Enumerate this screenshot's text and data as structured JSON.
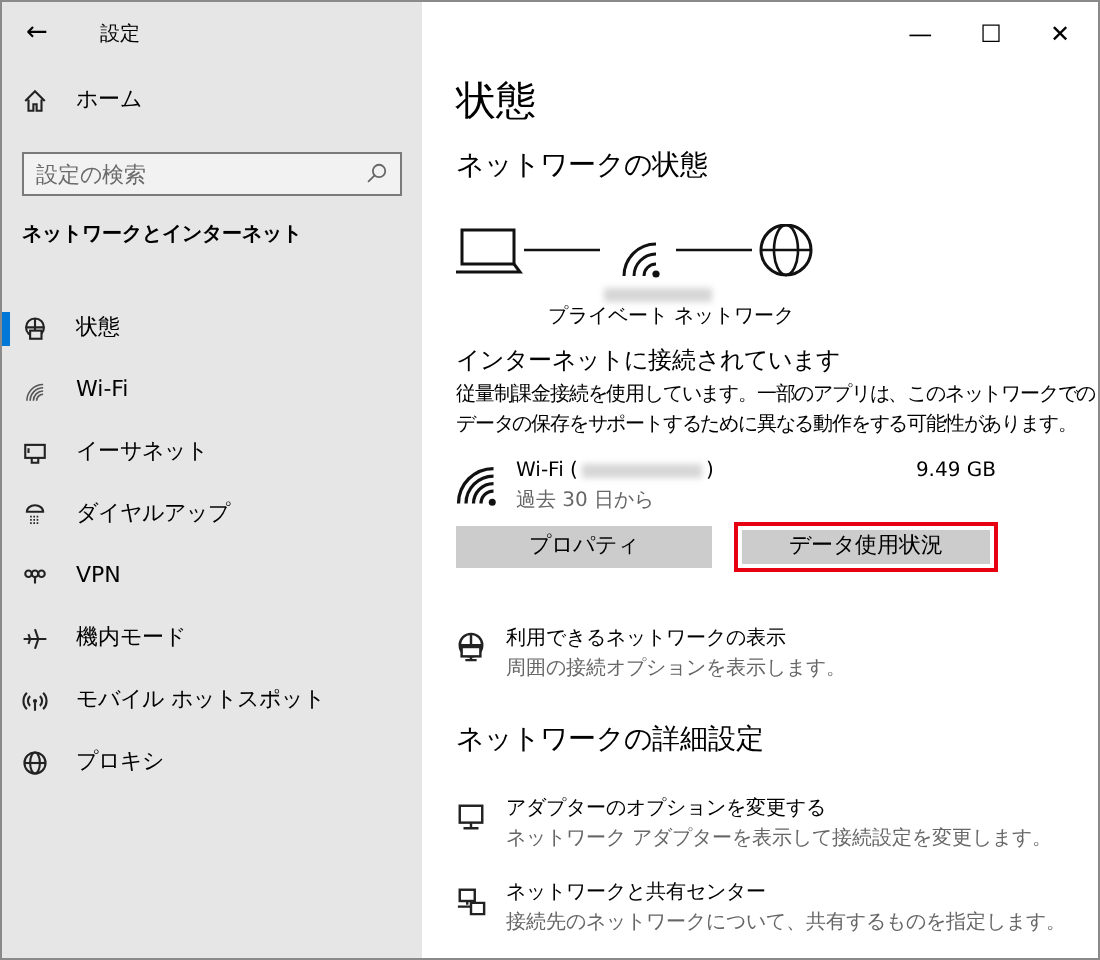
{
  "window": {
    "title": "設定",
    "back": "←",
    "controls": [
      "—",
      "☐",
      "✕"
    ]
  },
  "sidebar": {
    "home": "ホーム",
    "search": {
      "placeholder": "設定の検索"
    },
    "section": "ネットワークとインターネット",
    "items": [
      {
        "label": "状態",
        "selected": true
      },
      {
        "label": "Wi-Fi",
        "selected": false
      },
      {
        "label": "イーサネット",
        "selected": false
      },
      {
        "label": "ダイヤルアップ",
        "selected": false
      },
      {
        "label": "VPN",
        "selected": false
      },
      {
        "label": "機内モード",
        "selected": false
      },
      {
        "label": "モバイル ホットスポット",
        "selected": false
      },
      {
        "label": "プロキシ",
        "selected": false
      }
    ]
  },
  "main": {
    "title": "状態",
    "network_heading": "ネットワークの状態",
    "network_type": "プライベート ネットワーク",
    "connected": "インターネットに接続されています",
    "description": [
      "従量制課金接続を使用しています。一部のアプリは、このネットワークでの",
      "データの保存をサポートするために異なる動作をする可能性があります。"
    ],
    "connection": {
      "name_prefix": "Wi-Fi (",
      "name_suffix": ")",
      "period": "過去 30 日から",
      "usage": "9.49 GB"
    },
    "buttons": [
      {
        "label": "プロパティ",
        "highlighted": false
      },
      {
        "label": "データ使用状況",
        "highlighted": true
      }
    ],
    "links": [
      {
        "title": "利用できるネットワークの表示",
        "subtitle": "周囲の接続オプションを表示します。"
      }
    ],
    "advanced_heading": "ネットワークの詳細設定",
    "advanced": [
      {
        "title": "アダプターのオプションを変更する",
        "subtitle": "ネットワーク アダプターを表示して接続設定を変更します。"
      },
      {
        "title": "ネットワークと共有センター",
        "subtitle": "接続先のネットワークについて、共有するものを指定します。"
      }
    ]
  }
}
